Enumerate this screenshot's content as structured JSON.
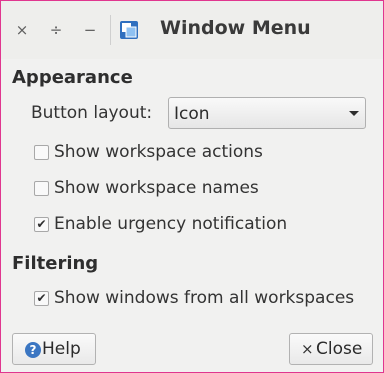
{
  "window": {
    "title": "Window Menu",
    "titlebar_buttons": [
      "×",
      "÷",
      "−"
    ]
  },
  "appearance": {
    "heading": "Appearance",
    "button_layout_label": "Button layout:",
    "button_layout_value": "Icon",
    "options": [
      {
        "label": "Show workspace actions",
        "checked": false
      },
      {
        "label": "Show workspace names",
        "checked": false
      },
      {
        "label": "Enable urgency notification",
        "checked": true
      }
    ]
  },
  "filtering": {
    "heading": "Filtering",
    "options": [
      {
        "label": "Show windows from all workspaces",
        "checked": true
      }
    ]
  },
  "buttons": {
    "help": "Help",
    "close": "Close"
  },
  "colors": {
    "border_accent": "#e0368f",
    "help_icon": "#3b76c2"
  },
  "icons": {
    "app": "window-menu-icon",
    "help": "help-icon",
    "close": "close-icon"
  }
}
